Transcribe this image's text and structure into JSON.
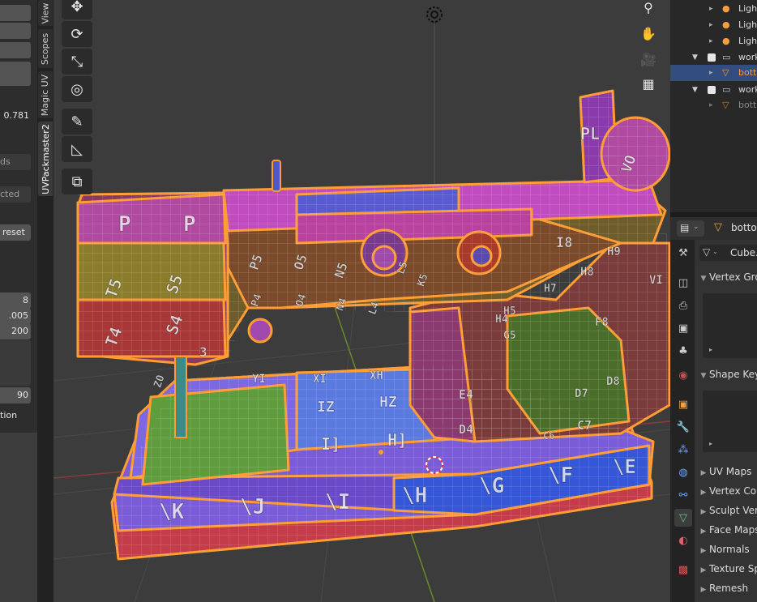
{
  "left_panel": {
    "value_781": "0.781",
    "label_ds": "ds",
    "label_cted": "cted",
    "reset_label": "reset",
    "value_8": "8",
    "value_005": ".005",
    "value_200": "200",
    "value_90": "90",
    "label_tion": "tion"
  },
  "sidebar_tabs": [
    "View",
    "Scopes",
    "Magic UV",
    "UVPackmaster2"
  ],
  "outliner": {
    "rows": [
      {
        "label": "Ligh"
      },
      {
        "label": "Ligh"
      },
      {
        "label": "Ligh"
      },
      {
        "label": "work"
      },
      {
        "label": "botto"
      },
      {
        "label": "work"
      },
      {
        "label": "botto"
      }
    ]
  },
  "properties": {
    "header_object": "botton",
    "mesh_name": "Cube.0",
    "sections": [
      {
        "label": "Vertex Gro"
      },
      {
        "label": "Shape Key"
      },
      {
        "label": "UV Maps"
      },
      {
        "label": "Vertex Co"
      },
      {
        "label": "Sculpt Ver"
      },
      {
        "label": "Face Maps"
      },
      {
        "label": "Normals"
      },
      {
        "label": "Texture Sp"
      },
      {
        "label": "Remesh"
      }
    ]
  },
  "model_labels": {
    "head_left": [
      "P",
      "P",
      "T5",
      "S5",
      "T4",
      "S4",
      "Z0",
      "3"
    ],
    "arm_front": [
      "P5",
      "O5",
      "N5",
      "P4",
      "O4",
      "N4",
      "L4",
      "K5",
      "L5"
    ],
    "body_right": [
      "I8",
      "H9",
      "H8",
      "H5",
      "H4",
      "H7",
      "G5",
      "F8",
      "E4",
      "D4",
      "C7",
      "D7",
      "D8",
      "VI",
      "C6"
    ],
    "base_top": [
      "IZ",
      "HZ",
      "I]",
      "H]",
      "YI",
      "XI",
      "XH"
    ],
    "base_front": [
      "\\K",
      "\\J",
      "\\I",
      "\\H",
      "\\G",
      "\\F",
      "\\E"
    ],
    "spool": [
      "PL",
      "VO"
    ]
  }
}
